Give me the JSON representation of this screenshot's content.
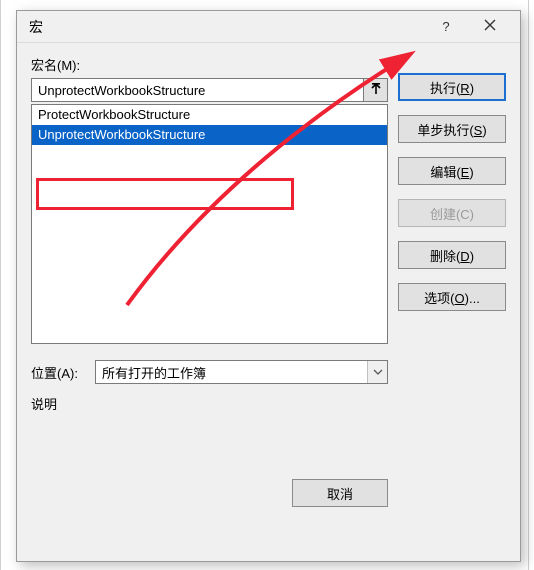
{
  "titlebar": {
    "title": "宏"
  },
  "macro_name": {
    "label": "宏名(M):",
    "value": "UnprotectWorkbookStructure"
  },
  "macro_list": [
    {
      "name": "ProtectWorkbookStructure",
      "selected": false
    },
    {
      "name": "UnprotectWorkbookStructure",
      "selected": true
    }
  ],
  "buttons": {
    "run": "执行(R)",
    "step": "单步执行(S)",
    "edit": "编辑(E)",
    "create": "创建(C)",
    "delete": "删除(D)",
    "options": "选项(O)...",
    "cancel": "取消"
  },
  "location": {
    "label": "位置(A):",
    "value": "所有打开的工作簿"
  },
  "description": {
    "label": "说明"
  },
  "icons": {
    "help": "help-icon",
    "close": "close-icon",
    "up_arrow": "up-arrow-icon",
    "chevron_down": "chevron-down-icon"
  }
}
